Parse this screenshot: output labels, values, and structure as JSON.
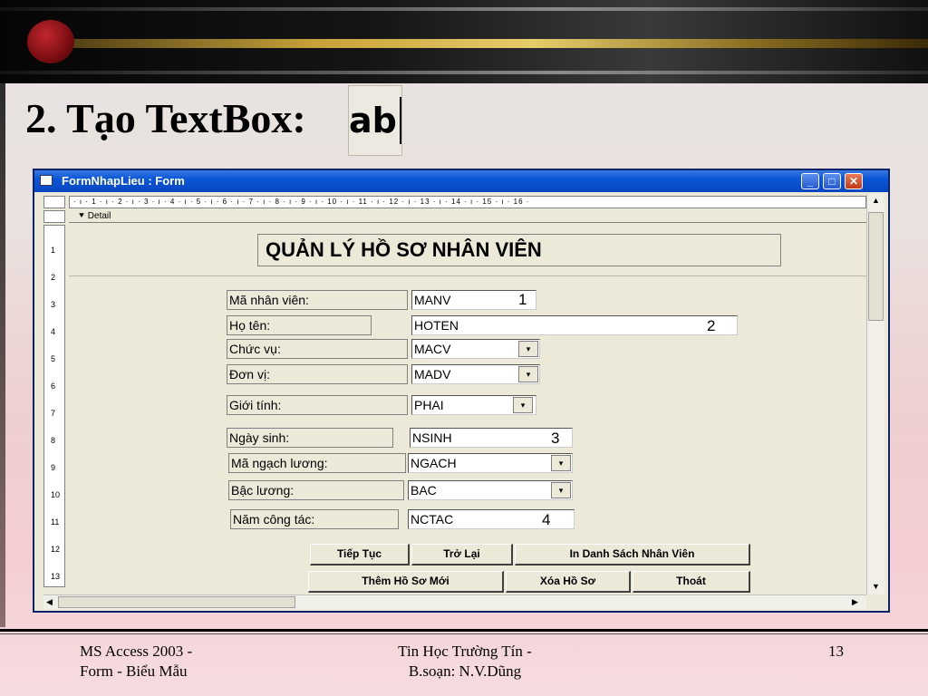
{
  "slide": {
    "title": "2. Tạo TextBox:",
    "tool_icon_label": "ab",
    "footer": {
      "left_line1": "MS Access 2003 -",
      "left_line2": "Form - Biểu Mẫu",
      "center_line1": "Tin Học Trường Tín -",
      "center_line2": "B.soạn: N.V.Dũng",
      "page_number": "13"
    }
  },
  "window": {
    "title": "FormNhapLieu : Form",
    "buttons": {
      "minimize": "_",
      "maximize": "□",
      "close": "✕"
    },
    "ruler_marks": "· ı · 1 · ı · 2 · ı · 3 · ı · 4 · ı · 5 · ı · 6 · ı · 7 · ı · 8 · ı · 9 · ı · 10 · ı · 11 · ı · 12 · ı · 13 · ı · 14 · ı · 15 · ı · 16 ·",
    "section_label": "Detail",
    "vertical_ruler": [
      "1",
      "2",
      "3",
      "4",
      "5",
      "6",
      "7",
      "8",
      "9",
      "10",
      "11",
      "12",
      "13"
    ]
  },
  "form": {
    "heading": "QUẢN LÝ HỒ SƠ NHÂN VIÊN",
    "fields": [
      {
        "label": "Mã nhân viên:",
        "value": "MANV",
        "marker": "1"
      },
      {
        "label": "Họ tên:",
        "value": "HOTEN",
        "marker": "2"
      },
      {
        "label": "Chức vụ:",
        "value": "MACV",
        "dropdown": "▾"
      },
      {
        "label": "Đơn vị:",
        "value": "MADV",
        "dropdown": "▾"
      },
      {
        "label": "Giới tính:",
        "value": "PHAI",
        "dropdown": "▾"
      },
      {
        "label": "Ngày sinh:",
        "value": "NSINH",
        "marker": "3"
      },
      {
        "label": "Mã ngạch lương:",
        "value": "NGACH",
        "dropdown": "▾"
      },
      {
        "label": "Bậc lương:",
        "value": "BAC",
        "dropdown": "▾"
      },
      {
        "label": "Năm công tác:",
        "value": "NCTAC",
        "marker": "4"
      }
    ],
    "buttons": {
      "continue": "Tiếp Tục",
      "back": "Trở Lại",
      "print_list": "In Danh Sách Nhân Viên",
      "add_new": "Thêm Hồ Sơ Mới",
      "delete": "Xóa Hồ Sơ",
      "exit": "Thoát"
    }
  }
}
